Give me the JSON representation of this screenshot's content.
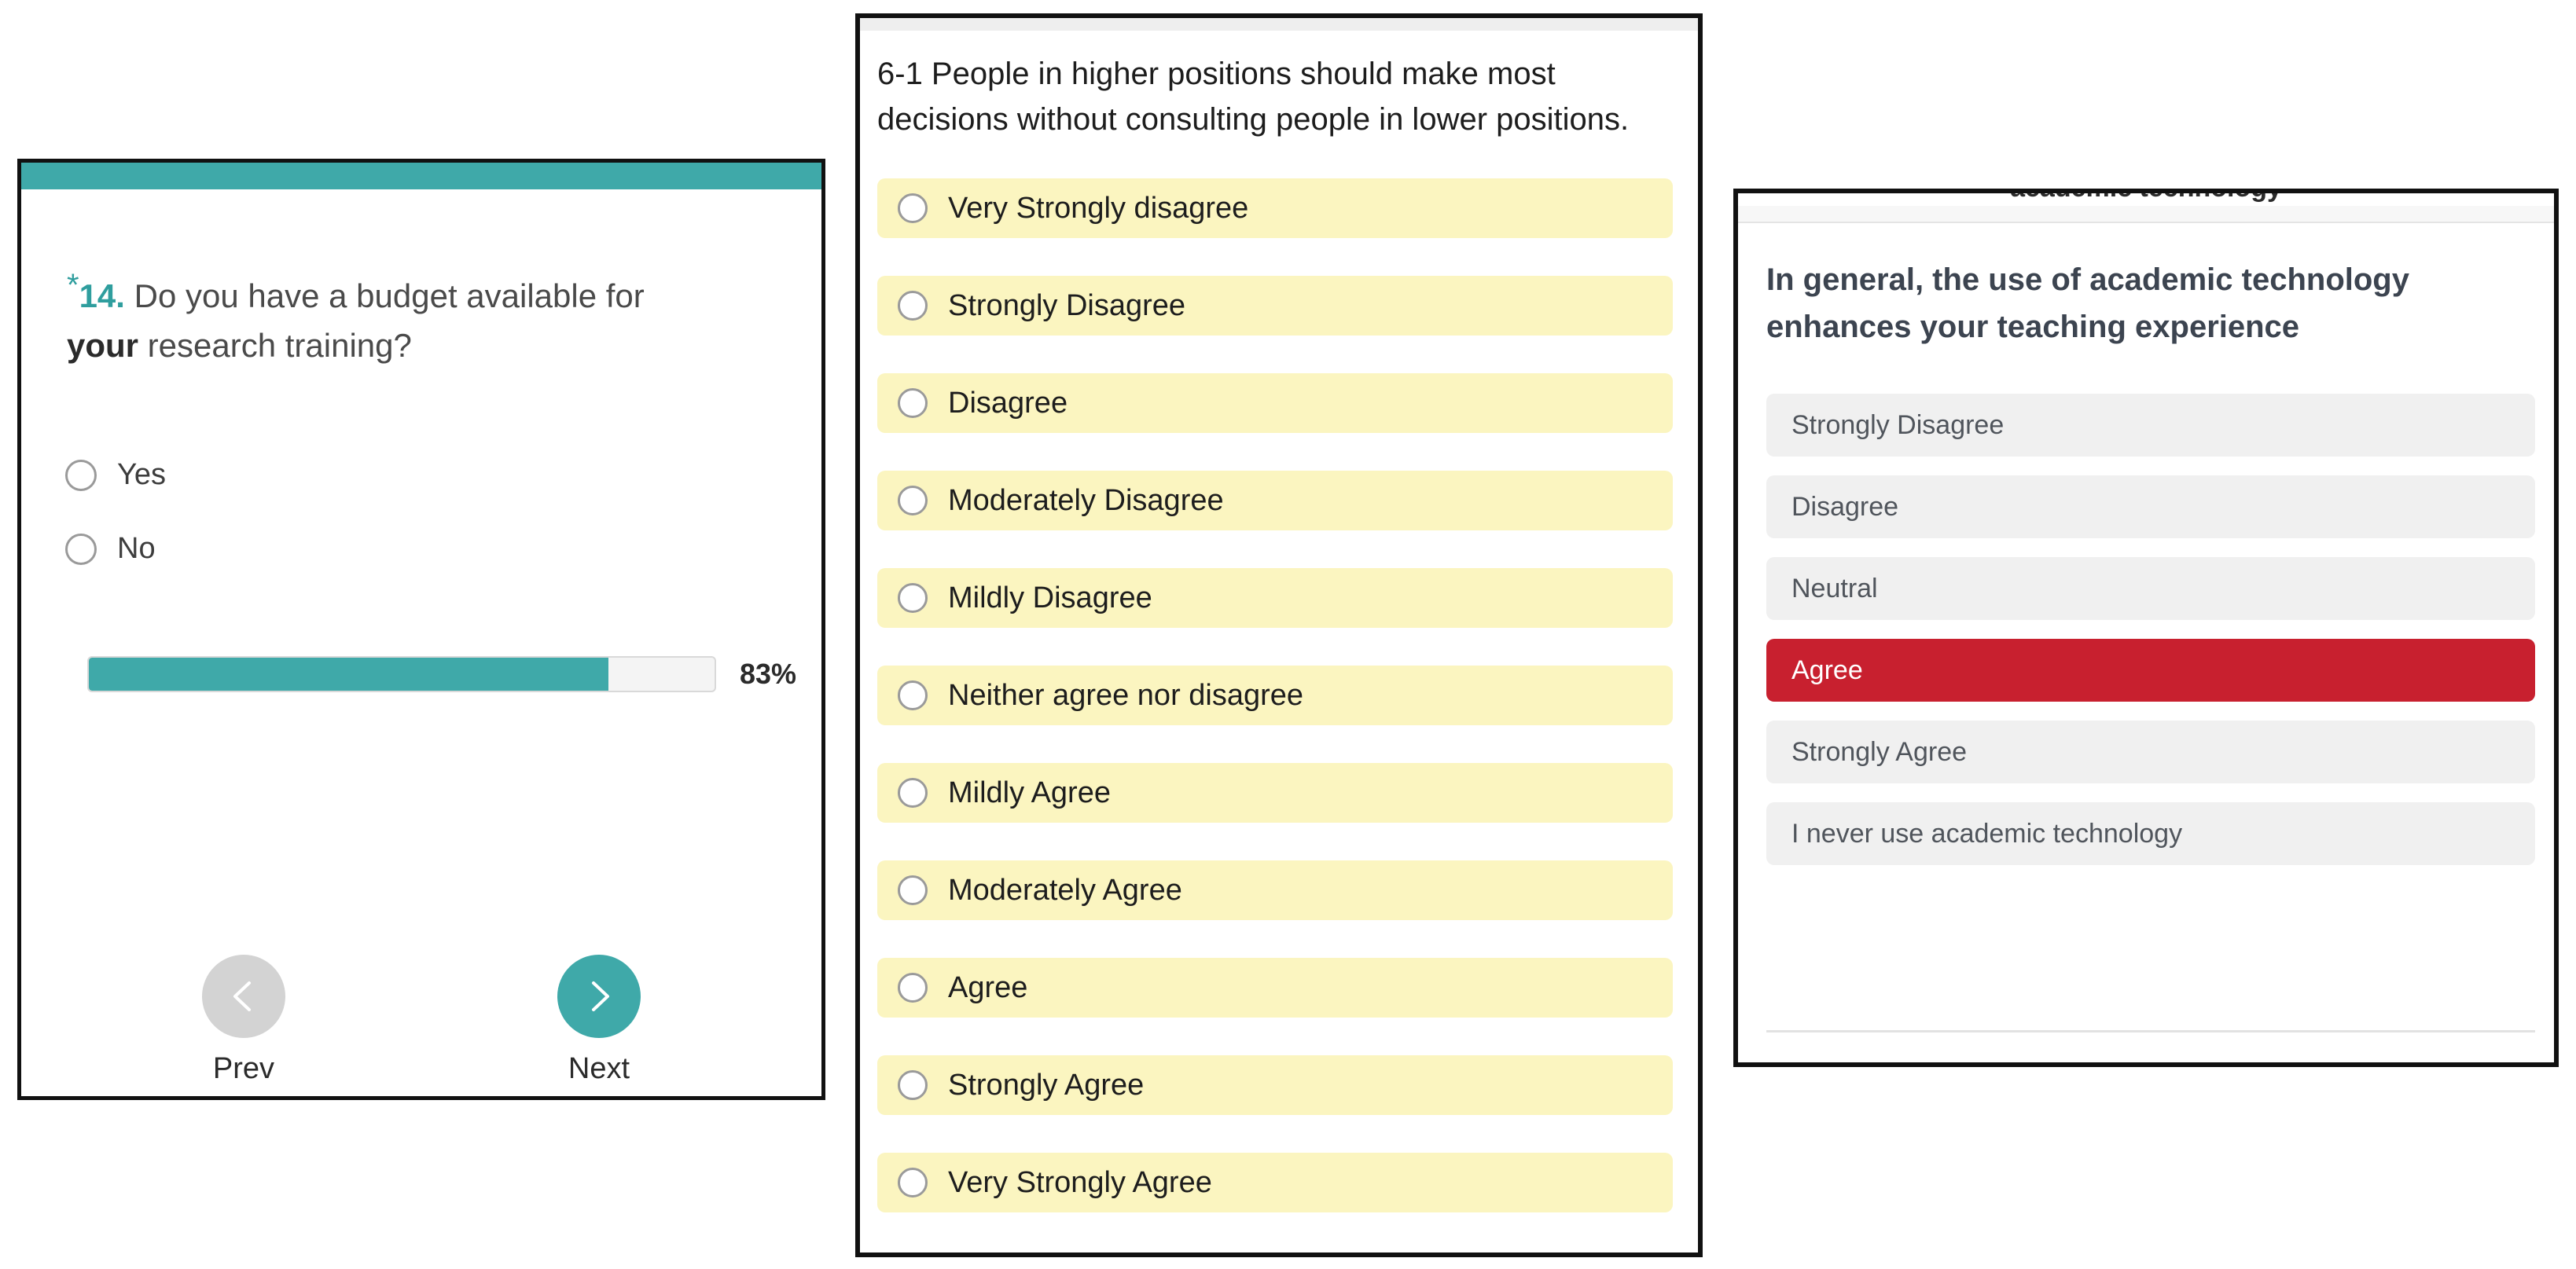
{
  "left_panel": {
    "header_bar_color": "#3FA9A9",
    "question": {
      "required_marker": "*",
      "number": "14.",
      "text_before_emphasis": " Do you have a budget available for ",
      "emphasis": "your",
      "text_after_emphasis": " research training?"
    },
    "options": [
      {
        "label": "Yes",
        "selected": false
      },
      {
        "label": "No",
        "selected": false
      }
    ],
    "progress": {
      "percent_label": "83%",
      "percent_value": 83
    },
    "navigation": {
      "prev_label": "Prev",
      "prev_icon": "chevron-left-icon",
      "prev_color": "#d3d3d3",
      "next_label": "Next",
      "next_icon": "chevron-right-icon",
      "next_color": "#3FA9A9"
    }
  },
  "middle_panel": {
    "question": "6-1 People in higher positions should make most decisions without consulting people in lower positions.",
    "option_background_color": "#FBF5C0",
    "options": [
      {
        "label": "Very Strongly disagree",
        "selected": false
      },
      {
        "label": "Strongly Disagree",
        "selected": false
      },
      {
        "label": "Disagree",
        "selected": false
      },
      {
        "label": "Moderately Disagree",
        "selected": false
      },
      {
        "label": "Mildly Disagree",
        "selected": false
      },
      {
        "label": "Neither agree nor disagree",
        "selected": false
      },
      {
        "label": "Mildly Agree",
        "selected": false
      },
      {
        "label": "Moderately Agree",
        "selected": false
      },
      {
        "label": "Agree",
        "selected": false
      },
      {
        "label": "Strongly Agree",
        "selected": false
      },
      {
        "label": "Very Strongly Agree",
        "selected": false
      }
    ]
  },
  "right_panel": {
    "clipped_header_text": "academic technology",
    "question": "In general, the use of academic technology enhances your teaching experience",
    "selected_color": "#C8202F",
    "option_background_color": "#f0f0f0",
    "options": [
      {
        "label": "Strongly Disagree",
        "selected": false
      },
      {
        "label": "Disagree",
        "selected": false
      },
      {
        "label": "Neutral",
        "selected": false
      },
      {
        "label": "Agree",
        "selected": true
      },
      {
        "label": "Strongly Agree",
        "selected": false
      },
      {
        "label": "I never use academic technology",
        "selected": false
      }
    ]
  }
}
